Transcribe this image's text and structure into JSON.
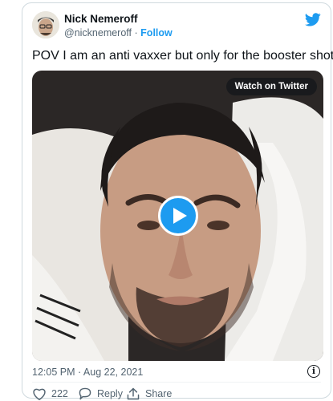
{
  "author": {
    "name": "Nick Nemeroff",
    "handle": "@nicknemeroff",
    "separator": "·",
    "follow_label": "Follow"
  },
  "tweet": {
    "text": "POV I am an anti vaxxer but only for the booster shot",
    "timestamp": "12:05 PM · Aug 22, 2021"
  },
  "media": {
    "watch_label": "Watch on Twitter",
    "play_icon": "play-icon"
  },
  "actions": {
    "like_count": "222",
    "reply_label": "Reply",
    "share_label": "Share"
  },
  "info_glyph": "i",
  "colors": {
    "brand": "#1d9bf0",
    "text": "#0f1419",
    "muted": "#536471",
    "border": "#cfd9de"
  }
}
